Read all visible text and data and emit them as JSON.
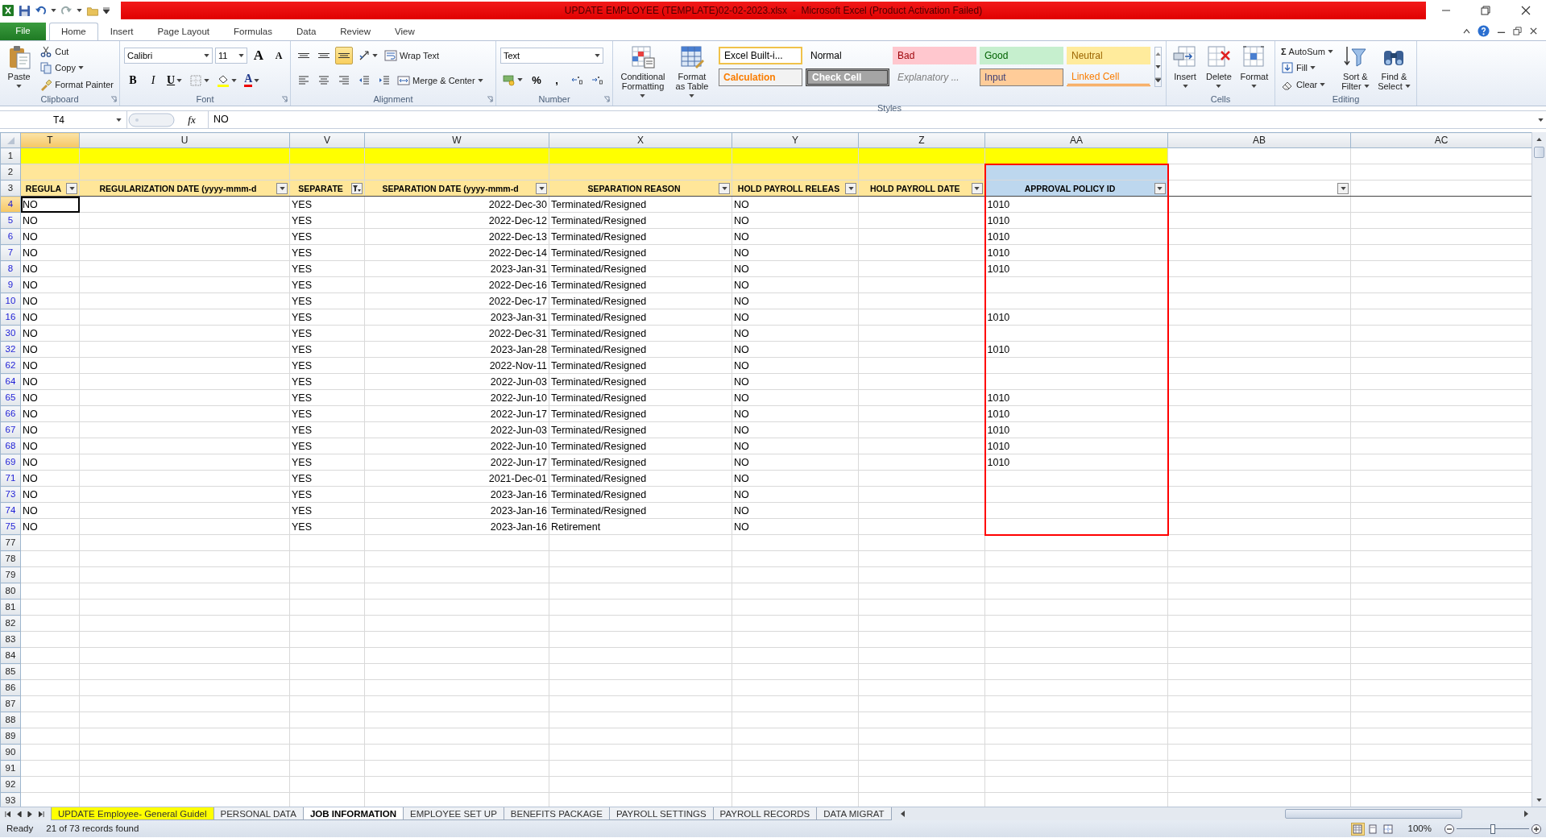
{
  "title_bar": {
    "title": "UPDATE EMPLOYEE (TEMPLATE)02-02-2023.xlsx  -  Microsoft Excel (Product Activation Failed)"
  },
  "ribbon_tabs": [
    {
      "label": "File",
      "kind": "file",
      "selected": false
    },
    {
      "label": "Home",
      "kind": "tab",
      "selected": true
    },
    {
      "label": "Insert",
      "kind": "tab",
      "selected": false
    },
    {
      "label": "Page Layout",
      "kind": "tab",
      "selected": false
    },
    {
      "label": "Formulas",
      "kind": "tab",
      "selected": false
    },
    {
      "label": "Data",
      "kind": "tab",
      "selected": false
    },
    {
      "label": "Review",
      "kind": "tab",
      "selected": false
    },
    {
      "label": "View",
      "kind": "tab",
      "selected": false
    }
  ],
  "ribbon_groups": [
    {
      "label": "Clipboard",
      "launcher": true,
      "columns": [
        {
          "kind": "large",
          "label": "Paste",
          "dropdown": true
        },
        {
          "kind": "stack",
          "rows": [
            [
              {
                "kind": "small",
                "label": "Cut",
                "dropdown": false
              }
            ],
            [
              {
                "kind": "small",
                "label": "Copy",
                "dropdown": true
              }
            ],
            [
              {
                "kind": "small",
                "label": "Format Painter",
                "dropdown": false
              }
            ]
          ]
        }
      ]
    },
    {
      "label": "Font",
      "launcher": true,
      "columns": [
        {
          "kind": "stack",
          "rows": [
            [
              {
                "kind": "font-combo",
                "value": "Calibri"
              },
              {
                "kind": "size-combo",
                "value": "11"
              },
              {
                "kind": "grow-glyph",
                "glyph": "A",
                "dropdown": false
              },
              {
                "kind": "shrink-glyph",
                "glyph": "A",
                "dropdown": false
              }
            ],
            [
              {
                "kind": "bold-glyph",
                "glyph": "B",
                "dropdown": false
              },
              {
                "kind": "italic-glyph",
                "glyph": "I",
                "dropdown": false
              },
              {
                "kind": "underline-glyph",
                "glyph": "U",
                "dropdown": true
              },
              {
                "kind": "icon",
                "dropdown": true
              },
              {
                "kind": "icon",
                "dropdown": true
              },
              {
                "kind": "color-glyph",
                "glyph": "A",
                "dropdown": true
              }
            ]
          ]
        }
      ]
    },
    {
      "label": "Alignment",
      "launcher": true,
      "columns": [
        {
          "kind": "stack",
          "rows": [
            [
              {
                "kind": "icon",
                "dropdown": false,
                "selected": false
              },
              {
                "kind": "icon",
                "dropdown": false,
                "selected": false
              },
              {
                "kind": "icon",
                "dropdown": false,
                "selected": true
              },
              {
                "kind": "icon",
                "dropdown": true
              },
              {
                "kind": "small",
                "label": "Wrap Text",
                "dropdown": false
              }
            ],
            [
              {
                "kind": "icon",
                "dropdown": false,
                "selected": false
              },
              {
                "kind": "icon",
                "dropdown": false,
                "selected": false
              },
              {
                "kind": "icon",
                "dropdown": false,
                "selected": false
              },
              {
                "kind": "icon",
                "dropdown": false
              },
              {
                "kind": "icon",
                "dropdown": false
              },
              {
                "kind": "small",
                "label": "Merge & Center",
                "dropdown": true
              }
            ]
          ]
        }
      ]
    },
    {
      "label": "Number",
      "launcher": true,
      "columns": [
        {
          "kind": "stack",
          "rows": [
            [
              {
                "kind": "format-combo",
                "value": "Text"
              }
            ],
            [
              {
                "kind": "icon",
                "dropdown": true
              },
              {
                "kind": "glyph",
                "glyph": "%",
                "dropdown": false
              },
              {
                "kind": "glyph",
                "glyph": ",",
                "dropdown": false
              },
              {
                "kind": "icon",
                "dropdown": false
              },
              {
                "kind": "icon",
                "dropdown": false
              }
            ]
          ]
        }
      ]
    },
    {
      "label": "Styles",
      "columns": [
        {
          "kind": "large",
          "label": "Conditional Formatting",
          "dropdown": true
        },
        {
          "kind": "large",
          "label": "Format as Table",
          "dropdown": true
        },
        {
          "kind": "gallery",
          "styles": [
            {
              "label": "Excel Built-i...",
              "kind": "builtin"
            },
            {
              "label": "Normal",
              "kind": "normal"
            },
            {
              "label": "Bad",
              "kind": "bad"
            },
            {
              "label": "Good",
              "kind": "good"
            },
            {
              "label": "Neutral",
              "kind": "neutral"
            },
            {
              "label": "Calculation",
              "kind": "calculation"
            },
            {
              "label": "Check Cell",
              "kind": "check"
            },
            {
              "label": "Explanatory ...",
              "kind": "explanatory"
            },
            {
              "label": "Input",
              "kind": "input"
            },
            {
              "label": "Linked Cell",
              "kind": "linked"
            }
          ]
        }
      ]
    },
    {
      "label": "Cells",
      "columns": [
        {
          "kind": "large",
          "label": "Insert",
          "dropdown": true
        },
        {
          "kind": "large",
          "label": "Delete",
          "dropdown": true
        },
        {
          "kind": "large",
          "label": "Format",
          "dropdown": true
        }
      ]
    },
    {
      "label": "Editing",
      "columns": [
        {
          "kind": "stack",
          "rows": [
            [
              {
                "kind": "glyph-small",
                "glyph": "Σ",
                "label": "AutoSum",
                "dropdown": true
              }
            ],
            [
              {
                "kind": "small",
                "label": "Fill",
                "dropdown": true
              }
            ],
            [
              {
                "kind": "small",
                "label": "Clear",
                "dropdown": true
              }
            ]
          ]
        },
        {
          "kind": "large",
          "label": "Sort & Filter",
          "dropdown": true
        },
        {
          "kind": "large",
          "label": "Find & Select",
          "dropdown": true
        }
      ]
    }
  ],
  "formula_bar": {
    "name_box": "T4",
    "function_glyph": "fx",
    "formula": "NO"
  },
  "sheet": {
    "columns": [
      {
        "label": "T",
        "selected": true,
        "outlined": false,
        "filter_button": true,
        "filter_active": false
      },
      {
        "label": "U",
        "selected": false,
        "outlined": false,
        "filter_button": true,
        "filter_active": false
      },
      {
        "label": "V",
        "selected": false,
        "outlined": false,
        "filter_button": true,
        "filter_active": true
      },
      {
        "label": "W",
        "selected": false,
        "outlined": false,
        "filter_button": true,
        "filter_active": false
      },
      {
        "label": "X",
        "selected": false,
        "outlined": false,
        "filter_button": true,
        "filter_active": false
      },
      {
        "label": "Y",
        "selected": false,
        "outlined": false,
        "filter_button": true,
        "filter_active": false
      },
      {
        "label": "Z",
        "selected": false,
        "outlined": false,
        "filter_button": true,
        "filter_active": false
      },
      {
        "label": "AA",
        "selected": false,
        "outlined": true,
        "filter_button": true,
        "filter_active": false
      },
      {
        "label": "AB",
        "selected": false,
        "outlined": false,
        "filter_button": true,
        "filter_active": false
      },
      {
        "label": "AC",
        "selected": false,
        "outlined": false,
        "filter_button": false
      }
    ],
    "rows": [
      {
        "number": "1",
        "kind": "title",
        "filtered": false,
        "selected": false
      },
      {
        "number": "2",
        "kind": "band",
        "filtered": false,
        "selected": false
      },
      {
        "number": "3",
        "kind": "header",
        "filtered": false,
        "selected": false,
        "cells": {
          "T": "REGULA",
          "U": "REGULARIZATION DATE (yyyy-mmm-d",
          "V": "SEPARATE",
          "W": "SEPARATION DATE (yyyy-mmm-d",
          "X": "SEPARATION REASON",
          "Y": "HOLD PAYROLL RELEAS",
          "Z": "HOLD PAYROLL DATE",
          "AA": "APPROVAL POLICY ID"
        }
      },
      {
        "number": "4",
        "kind": "data",
        "filtered": true,
        "selected": true,
        "cells": {
          "T": "NO",
          "V": "YES",
          "W": "2022-Dec-30",
          "X": "Terminated/Resigned",
          "Y": "NO",
          "AA": "1010"
        }
      },
      {
        "number": "5",
        "kind": "data",
        "filtered": true,
        "selected": false,
        "cells": {
          "T": "NO",
          "V": "YES",
          "W": "2022-Dec-12",
          "X": "Terminated/Resigned",
          "Y": "NO",
          "AA": "1010"
        }
      },
      {
        "number": "6",
        "kind": "data",
        "filtered": true,
        "selected": false,
        "cells": {
          "T": "NO",
          "V": "YES",
          "W": "2022-Dec-13",
          "X": "Terminated/Resigned",
          "Y": "NO",
          "AA": "1010"
        }
      },
      {
        "number": "7",
        "kind": "data",
        "filtered": true,
        "selected": false,
        "cells": {
          "T": "NO",
          "V": "YES",
          "W": "2022-Dec-14",
          "X": "Terminated/Resigned",
          "Y": "NO",
          "AA": "1010"
        }
      },
      {
        "number": "8",
        "kind": "data",
        "filtered": true,
        "selected": false,
        "cells": {
          "T": "NO",
          "V": "YES",
          "W": "2023-Jan-31",
          "X": "Terminated/Resigned",
          "Y": "NO",
          "AA": "1010"
        }
      },
      {
        "number": "9",
        "kind": "data",
        "filtered": true,
        "selected": false,
        "cells": {
          "T": "NO",
          "V": "YES",
          "W": "2022-Dec-16",
          "X": "Terminated/Resigned",
          "Y": "NO"
        }
      },
      {
        "number": "10",
        "kind": "data",
        "filtered": true,
        "selected": false,
        "cells": {
          "T": "NO",
          "V": "YES",
          "W": "2022-Dec-17",
          "X": "Terminated/Resigned",
          "Y": "NO"
        }
      },
      {
        "number": "16",
        "kind": "data",
        "filtered": true,
        "selected": false,
        "cells": {
          "T": "NO",
          "V": "YES",
          "W": "2023-Jan-31",
          "X": "Terminated/Resigned",
          "Y": "NO",
          "AA": "1010"
        }
      },
      {
        "number": "30",
        "kind": "data",
        "filtered": true,
        "selected": false,
        "cells": {
          "T": "NO",
          "V": "YES",
          "W": "2022-Dec-31",
          "X": "Terminated/Resigned",
          "Y": "NO"
        }
      },
      {
        "number": "32",
        "kind": "data",
        "filtered": true,
        "selected": false,
        "cells": {
          "T": "NO",
          "V": "YES",
          "W": "2023-Jan-28",
          "X": "Terminated/Resigned",
          "Y": "NO",
          "AA": "1010"
        }
      },
      {
        "number": "62",
        "kind": "data",
        "filtered": true,
        "selected": false,
        "cells": {
          "T": "NO",
          "V": "YES",
          "W": "2022-Nov-11",
          "X": "Terminated/Resigned",
          "Y": "NO"
        }
      },
      {
        "number": "64",
        "kind": "data",
        "filtered": true,
        "selected": false,
        "cells": {
          "T": "NO",
          "V": "YES",
          "W": "2022-Jun-03",
          "X": "Terminated/Resigned",
          "Y": "NO"
        }
      },
      {
        "number": "65",
        "kind": "data",
        "filtered": true,
        "selected": false,
        "cells": {
          "T": "NO",
          "V": "YES",
          "W": "2022-Jun-10",
          "X": "Terminated/Resigned",
          "Y": "NO",
          "AA": "1010"
        }
      },
      {
        "number": "66",
        "kind": "data",
        "filtered": true,
        "selected": false,
        "cells": {
          "T": "NO",
          "V": "YES",
          "W": "2022-Jun-17",
          "X": "Terminated/Resigned",
          "Y": "NO",
          "AA": "1010"
        }
      },
      {
        "number": "67",
        "kind": "data",
        "filtered": true,
        "selected": false,
        "cells": {
          "T": "NO",
          "V": "YES",
          "W": "2022-Jun-03",
          "X": "Terminated/Resigned",
          "Y": "NO",
          "AA": "1010"
        }
      },
      {
        "number": "68",
        "kind": "data",
        "filtered": true,
        "selected": false,
        "cells": {
          "T": "NO",
          "V": "YES",
          "W": "2022-Jun-10",
          "X": "Terminated/Resigned",
          "Y": "NO",
          "AA": "1010"
        }
      },
      {
        "number": "69",
        "kind": "data",
        "filtered": true,
        "selected": false,
        "cells": {
          "T": "NO",
          "V": "YES",
          "W": "2022-Jun-17",
          "X": "Terminated/Resigned",
          "Y": "NO",
          "AA": "1010"
        }
      },
      {
        "number": "71",
        "kind": "data",
        "filtered": true,
        "selected": false,
        "cells": {
          "T": "NO",
          "V": "YES",
          "W": "2021-Dec-01",
          "X": "Terminated/Resigned",
          "Y": "NO"
        }
      },
      {
        "number": "73",
        "kind": "data",
        "filtered": true,
        "selected": false,
        "cells": {
          "T": "NO",
          "V": "YES",
          "W": "2023-Jan-16",
          "X": "Terminated/Resigned",
          "Y": "NO"
        }
      },
      {
        "number": "74",
        "kind": "data",
        "filtered": true,
        "selected": false,
        "cells": {
          "T": "NO",
          "V": "YES",
          "W": "2023-Jan-16",
          "X": "Terminated/Resigned",
          "Y": "NO"
        }
      },
      {
        "number": "75",
        "kind": "data",
        "filtered": true,
        "selected": false,
        "cells": {
          "T": "NO",
          "V": "YES",
          "W": "2023-Jan-16",
          "X": "Retirement",
          "Y": "NO"
        }
      },
      {
        "number": "77",
        "kind": "empty",
        "filtered": false,
        "selected": false
      },
      {
        "number": "78",
        "kind": "empty",
        "filtered": false,
        "selected": false
      },
      {
        "number": "79",
        "kind": "empty",
        "filtered": false,
        "selected": false
      },
      {
        "number": "80",
        "kind": "empty",
        "filtered": false,
        "selected": false
      },
      {
        "number": "81",
        "kind": "empty",
        "filtered": false,
        "selected": false
      },
      {
        "number": "82",
        "kind": "empty",
        "filtered": false,
        "selected": false
      },
      {
        "number": "83",
        "kind": "empty",
        "filtered": false,
        "selected": false
      },
      {
        "number": "84",
        "kind": "empty",
        "filtered": false,
        "selected": false
      },
      {
        "number": "85",
        "kind": "empty",
        "filtered": false,
        "selected": false
      },
      {
        "number": "86",
        "kind": "empty",
        "filtered": false,
        "selected": false
      },
      {
        "number": "87",
        "kind": "empty",
        "filtered": false,
        "selected": false
      },
      {
        "number": "88",
        "kind": "empty",
        "filtered": false,
        "selected": false
      },
      {
        "number": "89",
        "kind": "empty",
        "filtered": false,
        "selected": false
      },
      {
        "number": "90",
        "kind": "empty",
        "filtered": false,
        "selected": false
      },
      {
        "number": "91",
        "kind": "empty",
        "filtered": false,
        "selected": false
      },
      {
        "number": "92",
        "kind": "empty",
        "filtered": false,
        "selected": false
      },
      {
        "number": "93",
        "kind": "empty",
        "filtered": false,
        "selected": false
      }
    ]
  },
  "sheet_tabs": [
    {
      "label": "UPDATE Employee- General Guidel",
      "selected": false,
      "color": "#ffff00"
    },
    {
      "label": "PERSONAL DATA",
      "selected": false
    },
    {
      "label": "JOB INFORMATION",
      "selected": true
    },
    {
      "label": "EMPLOYEE SET UP",
      "selected": false
    },
    {
      "label": "BENEFITS PACKAGE",
      "selected": false
    },
    {
      "label": "PAYROLL SETTINGS",
      "selected": false
    },
    {
      "label": "PAYROLL RECORDS",
      "selected": false
    },
    {
      "label": "DATA MIGRAT",
      "selected": false
    }
  ],
  "status_bar": {
    "mode": "Ready",
    "filter_status": "21 of 73 records found",
    "views": [
      {
        "selected": true
      },
      {
        "selected": false
      },
      {
        "selected": false
      }
    ],
    "zoom": {
      "reading": "100%",
      "level": 0.5
    }
  }
}
